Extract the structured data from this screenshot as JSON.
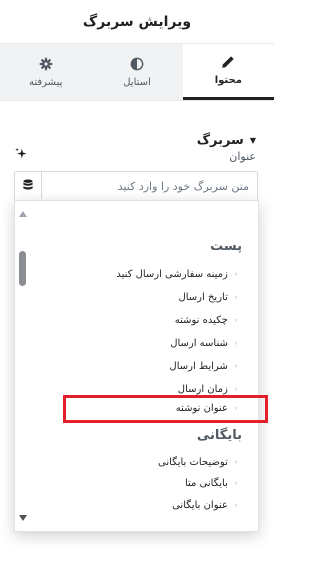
{
  "header": {
    "title": "ویرایش سربرگ"
  },
  "tabs": [
    {
      "label": "محتوا",
      "icon": "pencil-icon",
      "active": true
    },
    {
      "label": "استایل",
      "icon": "contrast-icon",
      "active": false
    },
    {
      "label": "پیشرفته",
      "icon": "gear-icon",
      "active": false
    }
  ],
  "section": {
    "title": "سربرگ"
  },
  "field": {
    "label": "عنوان",
    "placeholder": "متن سربرگ خود را وارد کنید"
  },
  "dropdown": {
    "group1": {
      "label": "پست",
      "items": [
        "زمینه سفارشی ارسال کنید",
        "تاریخ ارسال",
        "چکیده نوشته",
        "شناسه ارسال",
        "شرایط ارسال",
        "زمان ارسال",
        "عنوان نوشته"
      ]
    },
    "group2": {
      "label": "بایگانی",
      "items": [
        "توضیحات بایگانی",
        "بایگانی متا",
        "عنوان بایگانی"
      ]
    }
  },
  "colors": {
    "highlight": "#e3202a",
    "active_tab_border": "#1f2124",
    "tab_bg": "#f1f2f3"
  }
}
